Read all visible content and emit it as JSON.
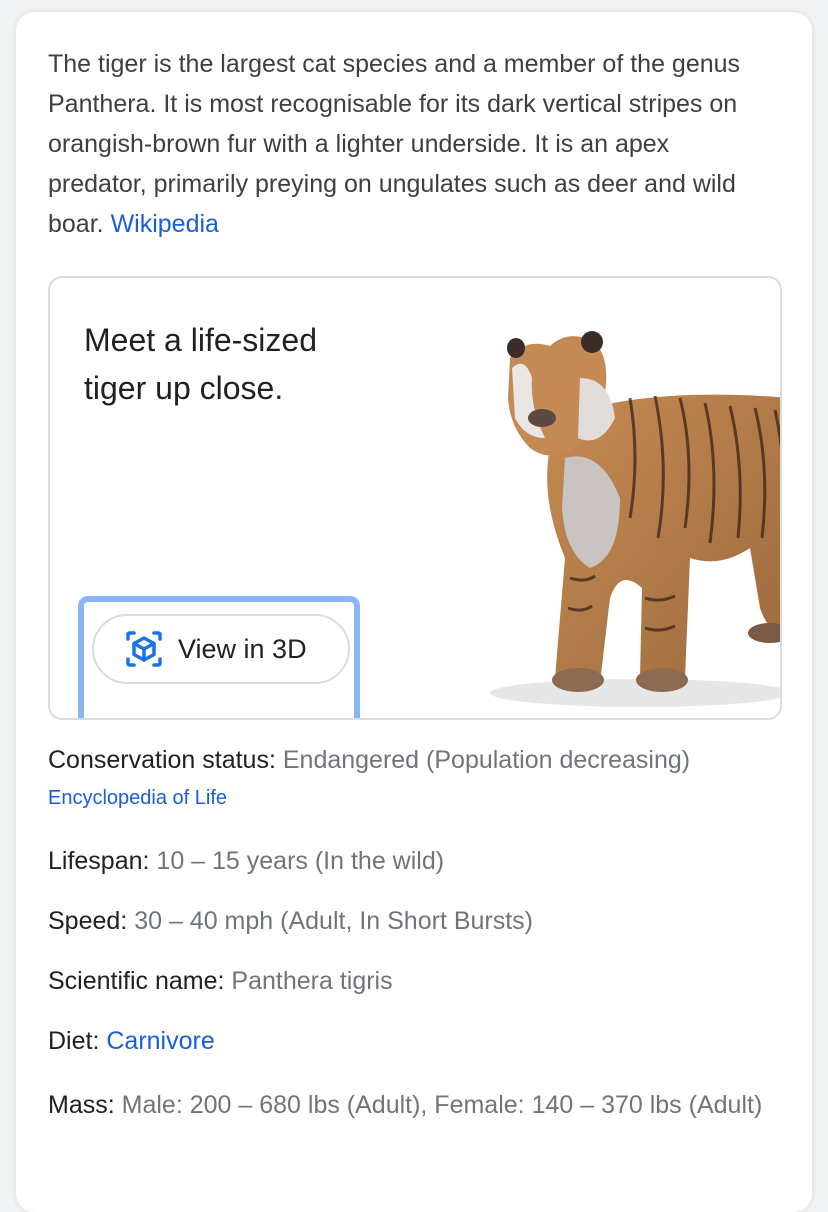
{
  "description": {
    "text": "The tiger is the largest cat species and a member of the genus Panthera. It is most recognisable for its dark vertical stripes on orangish-brown fur with a lighter underside. It is an apex predator, primarily preying on ungulates such as deer and wild boar.",
    "source_link": "Wikipedia"
  },
  "ar_card": {
    "title": "Meet a life-sized tiger up close.",
    "button_label": "View in 3D",
    "button_icon": "3d-cube-icon",
    "image": "tiger-3d-model"
  },
  "facts": [
    {
      "label": "Conservation status:",
      "value": "Endangered (Population decreasing)",
      "source": "Encyclopedia of Life"
    },
    {
      "label": "Lifespan:",
      "value": "10 – 15 years (In the wild)"
    },
    {
      "label": "Speed:",
      "value": "30 – 40 mph (Adult, In Short Bursts)"
    },
    {
      "label": "Scientific name:",
      "value": "Panthera tigris"
    },
    {
      "label": "Diet:",
      "value": "Carnivore",
      "value_is_link": true
    },
    {
      "label": "Mass:",
      "value": "Male: 200 – 680 lbs (Adult), Female: 140 – 370 lbs (Adult)"
    }
  ],
  "colors": {
    "link": "#1a5fd8",
    "value_gray": "#70757a",
    "focus_ring": "#8ab4f8"
  }
}
